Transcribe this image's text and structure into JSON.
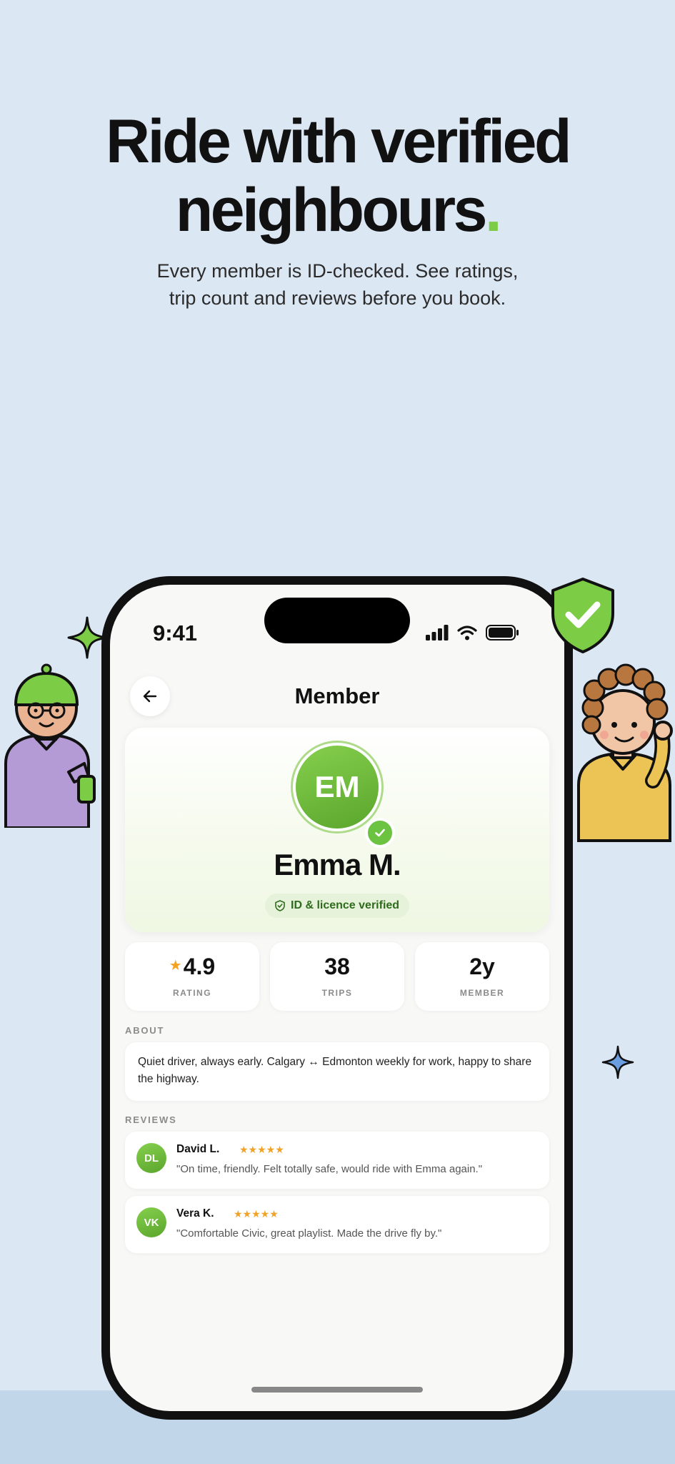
{
  "hero": {
    "headline_line1": "Ride with verified",
    "headline_line2": "neighbours",
    "headline_dot": ".",
    "subhead_line1": "Every member is ID-checked. See ratings,",
    "subhead_line2": "trip count and reviews before you book."
  },
  "status_bar": {
    "time": "9:41"
  },
  "nav": {
    "title": "Member"
  },
  "profile": {
    "initials": "EM",
    "name": "Emma M.",
    "verified_label": "ID & licence verified"
  },
  "stats": [
    {
      "value": "4.9",
      "label": "RATING"
    },
    {
      "value": "38",
      "label": "TRIPS"
    },
    {
      "value": "2y",
      "label": "MEMBER"
    }
  ],
  "about": {
    "label": "ABOUT",
    "text": "Quiet driver, always early. Calgary ↔ Edmonton weekly for work, happy to share the highway."
  },
  "reviews": {
    "label": "REVIEWS",
    "items": [
      {
        "initials": "DL",
        "name": "David L.",
        "stars": "★★★★★",
        "text": "\"On time, friendly. Felt totally safe, would ride with Emma again.\""
      },
      {
        "initials": "VK",
        "name": "Vera K.",
        "stars": "★★★★★",
        "text": "\"Comfortable Civic, great playlist. Made the drive fly by.\""
      }
    ]
  },
  "colors": {
    "accent_green": "#7ccc45",
    "star": "#f2a225",
    "background": "#dce7f4"
  },
  "icons": [
    "back-arrow-icon",
    "signal-icon",
    "wifi-icon",
    "battery-icon",
    "shield-check-icon",
    "check-icon",
    "sparkle-icon",
    "star-icon"
  ]
}
